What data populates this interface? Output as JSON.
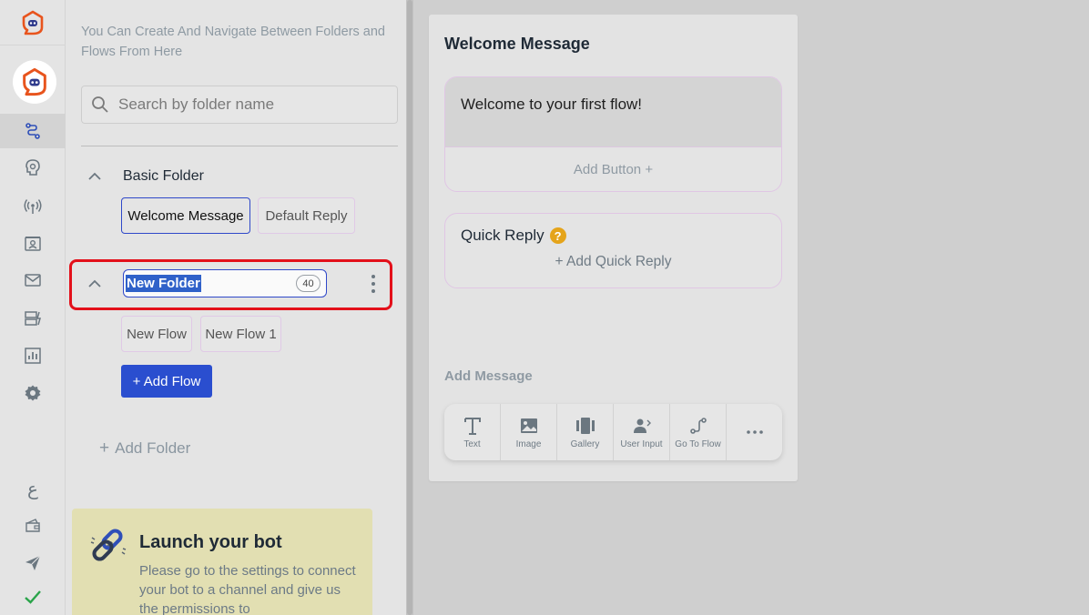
{
  "panel": {
    "intro": "You Can Create And Navigate Between Folders and Flows From Here",
    "search_placeholder": "Search by folder name"
  },
  "folders": [
    {
      "name": "Basic Folder",
      "flows": [
        "Welcome Message",
        "Default Reply"
      ],
      "selected_flow": "Welcome Message"
    },
    {
      "name": "New Folder",
      "name_char_counter": "40",
      "editing": true,
      "flows": [
        "New Flow",
        "New Flow 1"
      ]
    }
  ],
  "actions": {
    "add_flow": "+ Add Flow",
    "add_folder": "Add Folder",
    "add_folder_icon": "+"
  },
  "launch": {
    "title": "Launch your bot",
    "body": "Please go to the settings to connect your bot to a channel and give us the permissions to"
  },
  "editor": {
    "title": "Welcome Message",
    "message_text": "Welcome to your first flow!",
    "add_button": "Add Button +",
    "quick_reply_title": "Quick Reply",
    "quick_reply_help": "?",
    "add_quick_reply": "+ Add Quick Reply",
    "add_message_label": "Add Message",
    "tools": [
      {
        "label": "Text",
        "icon": "text-icon"
      },
      {
        "label": "Image",
        "icon": "image-icon"
      },
      {
        "label": "Gallery",
        "icon": "gallery-icon"
      },
      {
        "label": "User Input",
        "icon": "user-input-icon"
      },
      {
        "label": "Go To Flow",
        "icon": "go-to-flow-icon"
      },
      {
        "label": "",
        "icon": "more-icon"
      }
    ]
  },
  "rail": {
    "language_glyph": "ع",
    "items": [
      "flows-icon",
      "ai-brain-icon",
      "broadcast-icon",
      "contacts-icon",
      "mail-icon",
      "integrations-icon",
      "analytics-icon",
      "settings-icon"
    ]
  },
  "colors": {
    "brand_orange": "#e8541d",
    "brand_blue": "#2f3b8c",
    "primary_button": "#2a4ecf",
    "highlight_red": "#e3101a",
    "help_badge": "#e5a41a",
    "check_green": "#2aa44a"
  }
}
